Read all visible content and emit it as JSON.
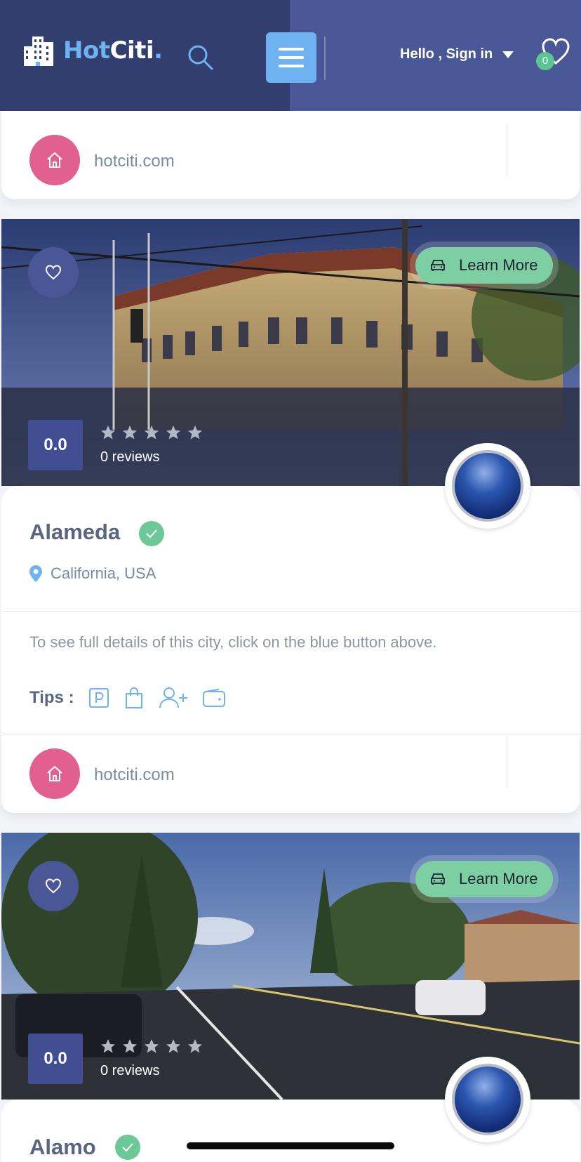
{
  "header": {
    "logo_hot": "Hot",
    "logo_citi": "Citi",
    "logo_dot": ".",
    "signin_label": "Hello , Sign in",
    "wishlist_count": "0"
  },
  "colors": {
    "header_left": "#323f6e",
    "header_right": "#4a5796",
    "accent_blue": "#6fb2f2",
    "home_pink": "#e2608f",
    "learn_green": "#7dcfa3",
    "rating_box": "#414e92",
    "verified_green": "#6cc896"
  },
  "top_partial_card": {
    "site": "hotciti.com"
  },
  "cards": [
    {
      "learn_more": "Learn More",
      "rating": "0.0",
      "stars": 0,
      "reviews": "0 reviews",
      "name": "Alameda",
      "verified": true,
      "location": "California, USA",
      "description": "To see full details of this city, click on the blue button above.",
      "tips_label": "Tips :",
      "tip_icons": [
        "parking-icon",
        "shopping-bag-icon",
        "add-user-icon",
        "wallet-icon"
      ],
      "site": "hotciti.com"
    },
    {
      "learn_more": "Learn More",
      "rating": "0.0",
      "stars": 0,
      "reviews": "0 reviews",
      "name": "Alamo",
      "verified": true
    }
  ]
}
